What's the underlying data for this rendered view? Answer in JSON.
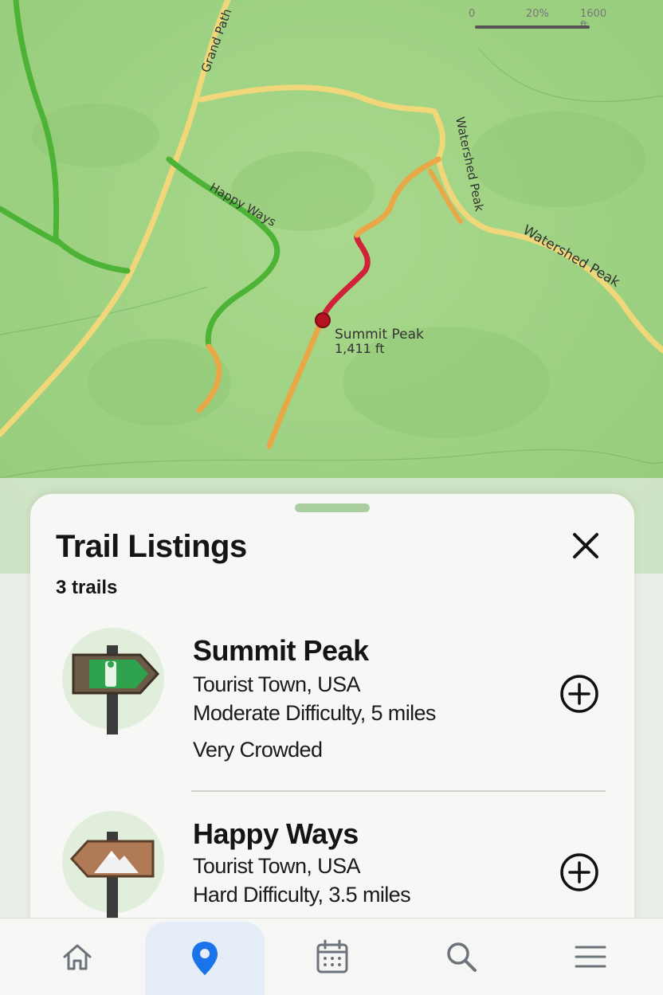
{
  "map": {
    "scale": {
      "start": "0",
      "mid": "20%",
      "end": "1600 ft"
    },
    "labels": {
      "grand_path": "Grand Path",
      "happy_ways": "Happy Ways",
      "watershed_peak_v": "Watershed Peak",
      "watershed_peak": "Watershed Peak",
      "summit_name": "Summit Peak",
      "summit_elev": "1,411 ft"
    },
    "trail_colors": {
      "green": "#4cb336",
      "yellow": "#efd77a",
      "orange": "#e9a848",
      "red": "#d0213a"
    }
  },
  "sheet": {
    "title": "Trail Listings",
    "count": "3 trails",
    "trails": [
      {
        "name": "Summit Peak",
        "location": "Tourist Town, USA",
        "details": "Moderate Difficulty, 5 miles",
        "crowd": "Very Crowded",
        "icon": "trail-sign-hiker-icon"
      },
      {
        "name": "Happy Ways",
        "location": "Tourist Town, USA",
        "details": "Hard Difficulty, 3.5 miles",
        "icon": "trail-sign-mountain-icon"
      }
    ]
  },
  "nav": {
    "items": [
      {
        "name": "home",
        "icon": "home-icon",
        "active": false
      },
      {
        "name": "map",
        "icon": "location-pin-icon",
        "active": true
      },
      {
        "name": "calendar",
        "icon": "calendar-icon",
        "active": false
      },
      {
        "name": "search",
        "icon": "search-icon",
        "active": false
      },
      {
        "name": "menu",
        "icon": "menu-icon",
        "active": false
      }
    ],
    "accent": "#1a73e8"
  }
}
